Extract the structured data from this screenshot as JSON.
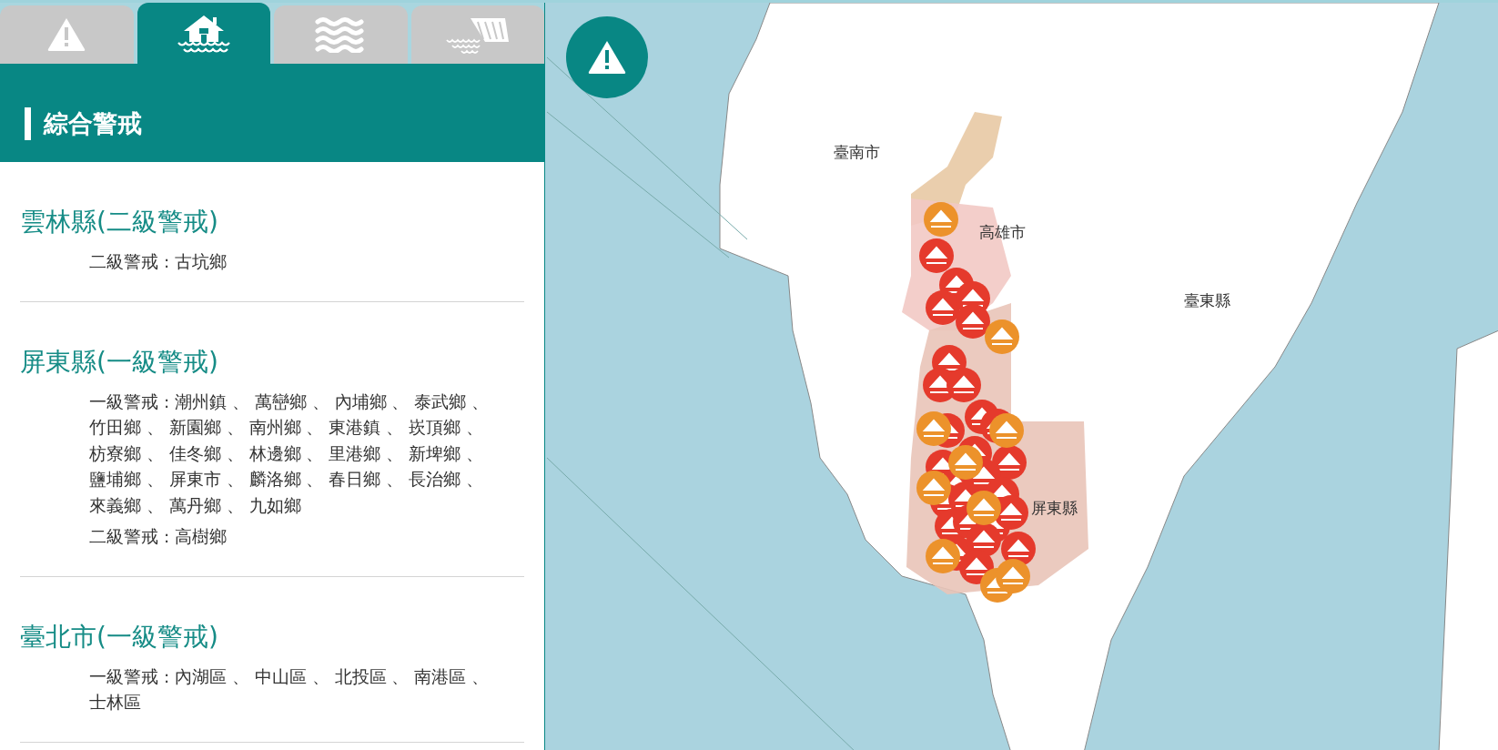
{
  "tabs": [
    {
      "kind": "warning",
      "selected": false
    },
    {
      "kind": "flood",
      "selected": true
    },
    {
      "kind": "waves",
      "selected": false
    },
    {
      "kind": "dam",
      "selected": false
    }
  ],
  "panel": {
    "title": "綜合警戒"
  },
  "alerts": [
    {
      "county": "雲林縣(二級警戒)",
      "lines": [
        [
          "二級警戒 : 古坑鄉"
        ]
      ]
    },
    {
      "county": "屏東縣(一級警戒)",
      "lines": [
        [
          "一級警戒 : 潮州鎮 、 萬巒鄉 、 內埔鄉 、 泰武鄉 、",
          "竹田鄉 、 新園鄉 、 南州鄉 、 東港鎮 、 崁頂鄉 、",
          "枋寮鄉 、 佳冬鄉 、 林邊鄉 、 里港鄉 、 新埤鄉 、",
          "鹽埔鄉 、 屏東市 、 麟洛鄉 、 春日鄉 、 長治鄉 、",
          "來義鄉 、 萬丹鄉 、 九如鄉"
        ],
        [
          "二級警戒 : 高樹鄉"
        ]
      ]
    },
    {
      "county": "臺北市(一級警戒)",
      "lines": [
        [
          "一級警戒 : 內湖區 、 中山區 、 北投區 、 南港區 、",
          "士林區"
        ]
      ]
    }
  ],
  "map": {
    "labels": [
      "臺南市",
      "高雄市",
      "臺東縣",
      "屏東縣"
    ]
  }
}
